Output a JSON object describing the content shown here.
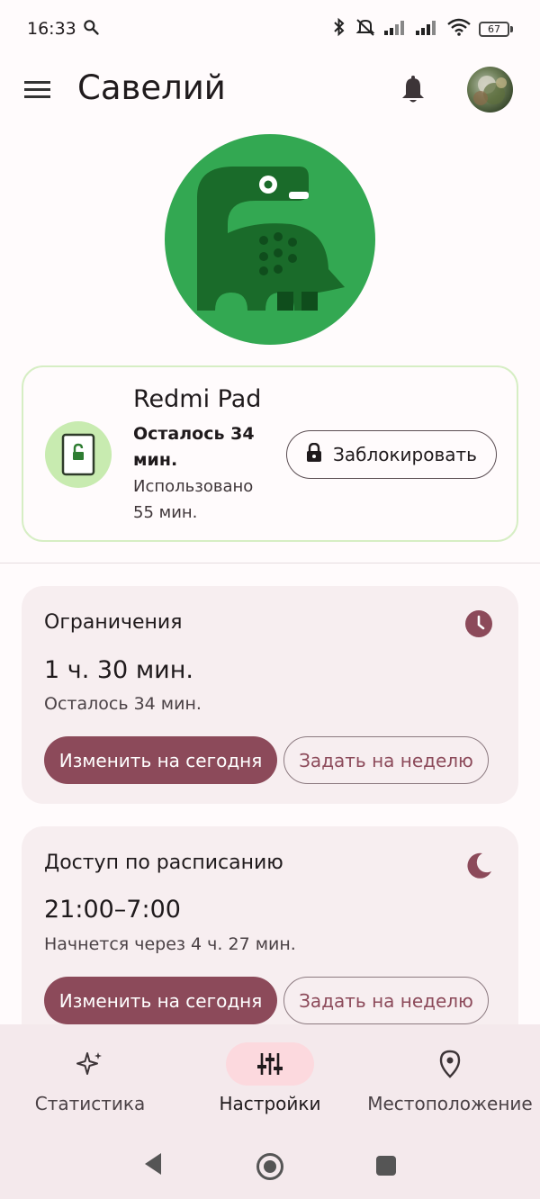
{
  "status_bar": {
    "time": "16:33",
    "battery": "67",
    "icons": [
      "search-icon",
      "bluetooth-icon",
      "mute-icon",
      "signal-icon",
      "signal-icon",
      "wifi-icon",
      "battery-icon"
    ]
  },
  "app_bar": {
    "title": "Савелий",
    "icons": [
      "menu-icon",
      "bell-icon",
      "avatar"
    ]
  },
  "device_card": {
    "name": "Redmi Pad",
    "time_left": "Осталось 34 мин.",
    "time_used": "Использовано 55 мин.",
    "lock_label": "Заблокировать"
  },
  "limits_card": {
    "title": "Ограничения",
    "value": "1 ч. 30 мин.",
    "sub": "Осталось 34 мин.",
    "primary_button": "Изменить на сегодня",
    "secondary_button": "Задать на неделю"
  },
  "schedule_card": {
    "title": "Доступ по расписанию",
    "value": "21:00–7:00",
    "sub": "Начнется через 4 ч. 27 мин.",
    "primary_button": "Изменить на сегодня",
    "secondary_button": "Задать на неделю"
  },
  "bottom_nav": {
    "items": [
      {
        "label": "Статистика",
        "icon": "sparkle-icon",
        "active": false
      },
      {
        "label": "Настройки",
        "icon": "sliders-icon",
        "active": true
      },
      {
        "label": "Местоположение",
        "icon": "location-pin-icon",
        "active": false
      }
    ]
  },
  "colors": {
    "accent": "#8c4a5a",
    "dino_bg": "#33a852",
    "card_bg": "#f7eef0",
    "nav_active": "#fcd9de"
  }
}
